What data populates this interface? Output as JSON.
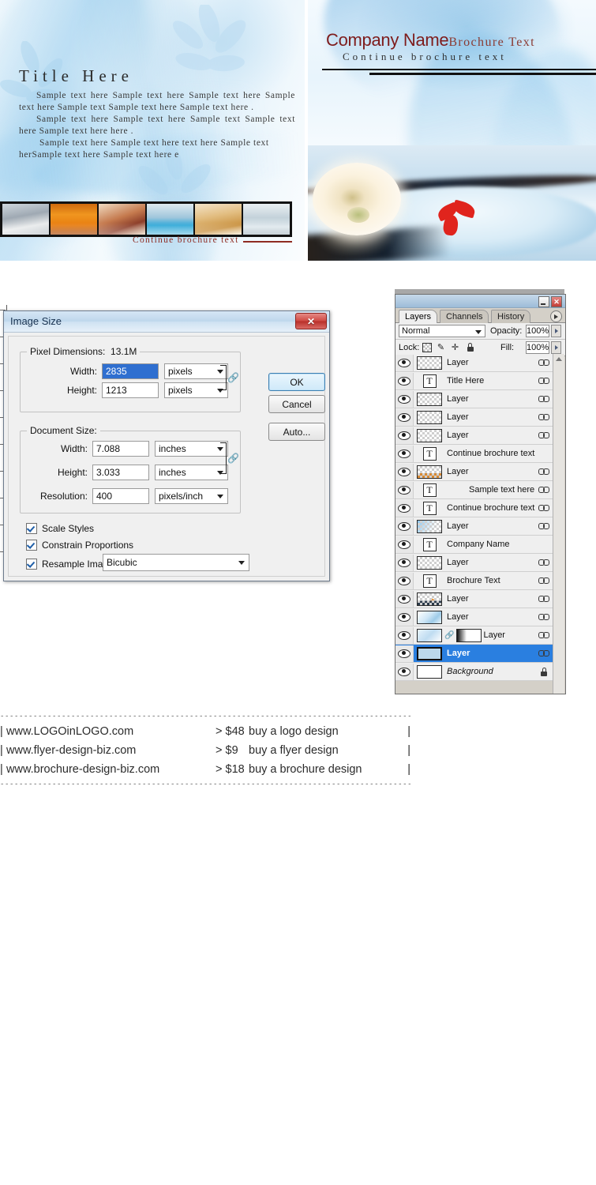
{
  "artwork": {
    "left_panel": {
      "title": "Title Here",
      "paragraphs": [
        "Sample text here Sample text here Sample text here Sample text here Sample text Sample text here Sample text here .",
        "Sample text here Sample text here Sample text Sample text here Sample text here here .",
        "Sample text here Sample text here text here Sample text herSample text here Sample text here e"
      ],
      "continue_label": "Continue brochure text",
      "thumbnails": [
        "spa-loungers-thumb",
        "orange-corridor-thumb",
        "reception-desk-thumb",
        "indoor-pool-thumb",
        "treatment-room-thumb",
        "locker-room-thumb"
      ]
    },
    "right_panel": {
      "company_name": "Company Name",
      "brochure_text": "Brochure Text",
      "continue_label": "Continue brochure text",
      "photo": "rose-in-water-photo"
    }
  },
  "dialog": {
    "title": "Image Size",
    "close_label": "✕",
    "pixel_dimensions": {
      "legend": "Pixel Dimensions:",
      "size": "13.1M",
      "width_label": "Width:",
      "width_value": "2835",
      "width_unit": "pixels",
      "height_label": "Height:",
      "height_value": "1213",
      "height_unit": "pixels"
    },
    "document_size": {
      "legend": "Document Size:",
      "width_label": "Width:",
      "width_value": "7.088",
      "width_unit": "inches",
      "height_label": "Height:",
      "height_value": "3.033",
      "height_unit": "inches",
      "resolution_label": "Resolution:",
      "resolution_value": "400",
      "resolution_unit": "pixels/inch"
    },
    "checkboxes": [
      {
        "label": "Scale Styles",
        "checked": true
      },
      {
        "label": "Constrain Proportions",
        "checked": true
      }
    ],
    "resample": {
      "label": "Resample Image:",
      "checked": true,
      "value": "Bicubic"
    },
    "buttons": {
      "ok": "OK",
      "cancel": "Cancel",
      "auto": "Auto..."
    }
  },
  "layers_panel": {
    "close_label": "✕",
    "tabs": [
      {
        "label": "Layers",
        "active": true
      },
      {
        "label": "Channels",
        "active": false
      },
      {
        "label": "History",
        "active": false
      }
    ],
    "blend_mode": "Normal",
    "opacity_label": "Opacity:",
    "opacity_value": "100%",
    "lock_label": "Lock:",
    "lock_icons": [
      "lock-transparency-icon",
      "lock-image-icon",
      "lock-position-icon",
      "lock-all-icon"
    ],
    "fill_label": "Fill:",
    "fill_value": "100%",
    "layers": [
      {
        "name": "Layer",
        "kind": "raster",
        "thumb": "checker",
        "link": true,
        "selected": false,
        "locked": false,
        "indent": false
      },
      {
        "name": "Title Here",
        "kind": "text",
        "thumb": "T",
        "link": true,
        "selected": false,
        "locked": false,
        "indent": false
      },
      {
        "name": "Layer",
        "kind": "raster",
        "thumb": "checker",
        "link": true,
        "selected": false,
        "locked": false,
        "indent": false
      },
      {
        "name": "Layer",
        "kind": "raster",
        "thumb": "checker",
        "link": true,
        "selected": false,
        "locked": false,
        "indent": false
      },
      {
        "name": "Layer",
        "kind": "raster",
        "thumb": "checker",
        "link": true,
        "selected": false,
        "locked": false,
        "indent": false
      },
      {
        "name": "Continue brochure text",
        "kind": "text",
        "thumb": "T",
        "link": false,
        "selected": false,
        "locked": false,
        "indent": false
      },
      {
        "name": "Layer",
        "kind": "raster",
        "thumb": "checker-art",
        "link": true,
        "selected": false,
        "locked": false,
        "indent": false
      },
      {
        "name": "Sample text here ...",
        "kind": "text",
        "thumb": "T",
        "link": true,
        "selected": false,
        "locked": false,
        "indent": true
      },
      {
        "name": "Continue brochure text",
        "kind": "text",
        "thumb": "T",
        "link": true,
        "selected": false,
        "locked": false,
        "indent": false
      },
      {
        "name": "Layer",
        "kind": "raster",
        "thumb": "checker-blue",
        "link": true,
        "selected": false,
        "locked": false,
        "indent": false
      },
      {
        "name": "Company Name",
        "kind": "text",
        "thumb": "T",
        "link": false,
        "selected": false,
        "locked": false,
        "indent": false
      },
      {
        "name": "Layer",
        "kind": "raster",
        "thumb": "checker",
        "link": true,
        "selected": false,
        "locked": false,
        "indent": false
      },
      {
        "name": "Brochure Text",
        "kind": "text",
        "thumb": "T",
        "link": true,
        "selected": false,
        "locked": false,
        "indent": false
      },
      {
        "name": "Layer",
        "kind": "raster",
        "thumb": "checker-rose",
        "link": true,
        "selected": false,
        "locked": false,
        "indent": false
      },
      {
        "name": "Layer",
        "kind": "raster",
        "thumb": "water",
        "link": true,
        "selected": false,
        "locked": false,
        "indent": false
      },
      {
        "name": "Layer",
        "kind": "masked",
        "thumb": "water-mask",
        "link": true,
        "selected": false,
        "locked": false,
        "indent": false
      },
      {
        "name": "Layer",
        "kind": "raster",
        "thumb": "solid-blue",
        "link": true,
        "selected": true,
        "locked": false,
        "indent": false
      },
      {
        "name": "Background",
        "kind": "background",
        "thumb": "white",
        "link": false,
        "selected": false,
        "locked": true,
        "indent": false
      }
    ]
  },
  "footer": {
    "divider": "---------------------------------------------------------------------------------------",
    "rows": [
      {
        "bar": "|",
        "url": "www.LOGOinLOGO.com",
        "gt": ">",
        "price": "$48",
        "desc": "buy a logo design",
        "bar_end": "|"
      },
      {
        "bar": "|",
        "url": "www.flyer-design-biz.com",
        "gt": ">",
        "price": "$9",
        "desc": "buy a flyer design",
        "bar_end": "|"
      },
      {
        "bar": "|",
        "url": "www.brochure-design-biz.com",
        "gt": ">",
        "price": "$18",
        "desc": "buy a brochure design",
        "bar_end": "|"
      }
    ]
  },
  "colors": {
    "accent_red": "#7e1c1c",
    "selection_blue": "#2a7fe0",
    "dialog_bg": "#f0f0f0",
    "panel_bg": "#efefef"
  }
}
